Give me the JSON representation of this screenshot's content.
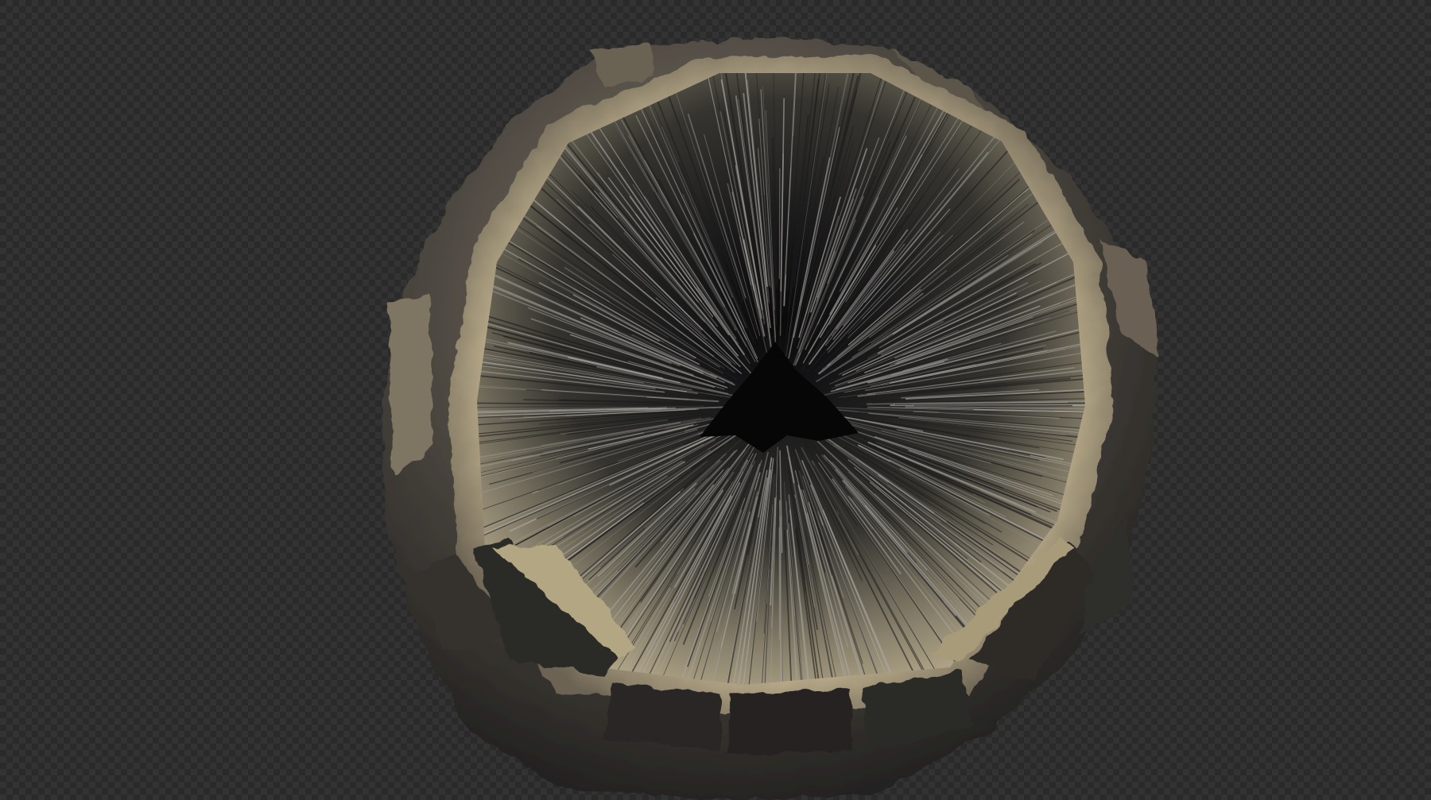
{
  "scene": {
    "subject": "stone-sphere-render",
    "background": "transparency-checkerboard",
    "colors": {
      "checker_dark": "#2a2a2a",
      "checker_light": "#333333",
      "stone_light": "#cbbd9b",
      "stone_mid": "#7d7262",
      "stone_dark": "#2e2c2a",
      "cavity_core": "#0d0d0e",
      "fiber_light": "#a9a6a0"
    }
  }
}
